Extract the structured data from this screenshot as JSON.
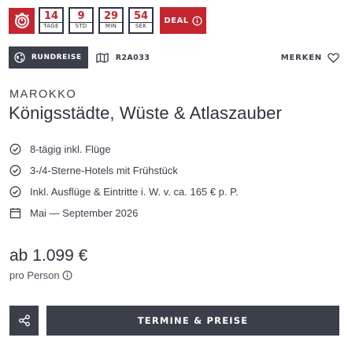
{
  "countdown": {
    "cells": [
      {
        "value": "14",
        "unit": "TAGE"
      },
      {
        "value": "9",
        "unit": "STD"
      },
      {
        "value": "29",
        "unit": "MIN"
      },
      {
        "value": "54",
        "unit": "SEK"
      }
    ],
    "deal_label": "DEAL"
  },
  "trip": {
    "type_label": "RUNDREISE",
    "code": "R2A033",
    "merken_label": "MERKEN",
    "country": "MAROKKO",
    "title": "Königsstädte, Wüste & Atlaszauber",
    "features": [
      "8-tägig inkl. Flüge",
      "3-/4-Sterne-Hotels mit Frühstück",
      "Inkl. Ausflüge & Eintritte i. W. v. ca. 165 € p. P."
    ],
    "travel_period": "Mai — September 2026"
  },
  "price": {
    "amount": "ab 1.099 €",
    "per_person": "pro Person"
  },
  "actions": {
    "cta_label": "TERMINE & PREISE"
  },
  "colors": {
    "accent_red": "#c4252f",
    "dark": "#3a3f4a"
  },
  "icons": [
    "stopwatch-icon",
    "info-icon",
    "globe-icon",
    "map-icon",
    "heart-icon",
    "check-circle-icon",
    "calendar-icon",
    "share-icon"
  ]
}
